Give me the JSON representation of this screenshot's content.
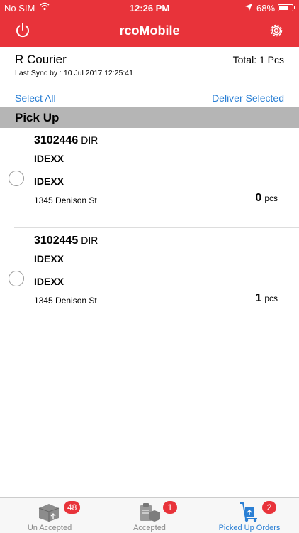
{
  "status_bar": {
    "carrier": "No SIM",
    "time": "12:26 PM",
    "battery": "68%"
  },
  "header": {
    "title": "rcoMobile"
  },
  "info": {
    "courier": "R Courier",
    "total": "Total: 1 Pcs",
    "last_sync": "Last Sync by : 10 Jul 2017 12:25:41",
    "select_all": "Select All",
    "deliver_selected": "Deliver Selected"
  },
  "section": {
    "title": "Pick Up"
  },
  "orders": [
    {
      "number": "3102446",
      "type": "DIR",
      "line1": "IDEXX",
      "line2": "IDEXX",
      "address": "1345 Denison St",
      "qty": "0",
      "unit": "pcs"
    },
    {
      "number": "3102445",
      "type": "DIR",
      "line1": "IDEXX",
      "line2": "IDEXX",
      "address": "1345 Denison St",
      "qty": "1",
      "unit": "pcs"
    }
  ],
  "tabs": [
    {
      "label": "Un Accepted",
      "badge": "48",
      "icon": "box-icon",
      "active": false
    },
    {
      "label": "Accepted",
      "badge": "1",
      "icon": "clipboard-box-icon",
      "active": false
    },
    {
      "label": "Picked Up Orders",
      "badge": "2",
      "icon": "hand-truck-icon",
      "active": true
    }
  ],
  "colors": {
    "brand": "#e8333a",
    "link": "#2a7fd4",
    "section_bg": "#b5b5b5"
  }
}
